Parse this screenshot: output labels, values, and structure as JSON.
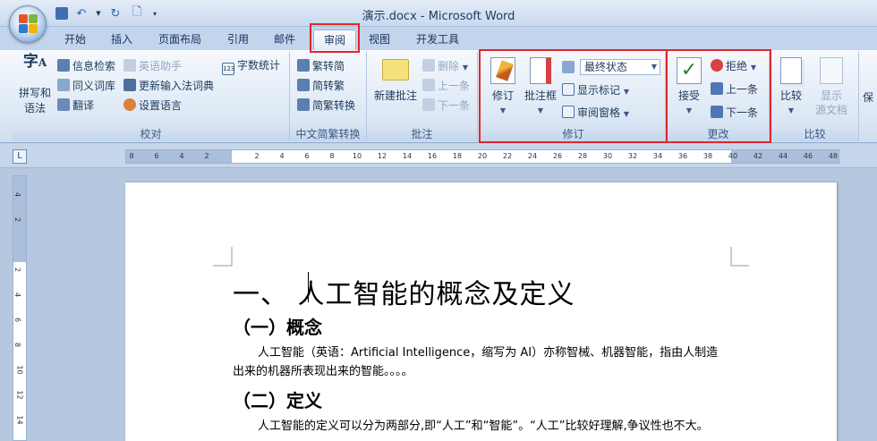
{
  "window": {
    "title": "演示.docx - Microsoft Word"
  },
  "quick_access": [
    "save-icon",
    "undo-icon",
    "redo-icon",
    "print-preview-icon",
    "customize-icon"
  ],
  "tabs": [
    {
      "label": "开始"
    },
    {
      "label": "插入"
    },
    {
      "label": "页面布局"
    },
    {
      "label": "引用"
    },
    {
      "label": "邮件"
    },
    {
      "label": "审阅",
      "active": true
    },
    {
      "label": "视图"
    },
    {
      "label": "开发工具"
    }
  ],
  "ribbon": {
    "proofing": {
      "label": "校对",
      "spell": "拼写和",
      "spell2": "语法",
      "research": "信息检索",
      "thesaurus": "同义词库",
      "translate": "翻译",
      "english_assist": "英语助手",
      "update_ime": "更新输入法词典",
      "set_language": "设置语言",
      "word_count": "字数统计"
    },
    "chinese": {
      "label": "中文简繁转换",
      "to_simplified": "繁转简",
      "to_traditional": "简转繁",
      "convert": "简繁转换"
    },
    "comments": {
      "label": "批注",
      "new": "新建批注",
      "delete": "删除",
      "previous": "上一条",
      "next": "下一条"
    },
    "tracking": {
      "label": "修订",
      "track": "修订",
      "balloons": "批注框",
      "display": "最终状态",
      "show_markup": "显示标记",
      "reviewing_pane": "审阅窗格"
    },
    "changes": {
      "label": "更改",
      "accept": "接受",
      "reject": "拒绝",
      "previous": "上一条",
      "next": "下一条"
    },
    "compare": {
      "label": "比较",
      "compare": "比较",
      "show_source": "显示",
      "show_source2": "源文档",
      "protect": "保"
    }
  },
  "ruler": {
    "ticks": [
      "8",
      "6",
      "4",
      "2",
      "",
      "2",
      "4",
      "6",
      "8",
      "10",
      "12",
      "14",
      "16",
      "18",
      "20",
      "22",
      "24",
      "26",
      "28",
      "30",
      "32",
      "34",
      "36",
      "38",
      "40",
      "42",
      "44",
      "46",
      "48"
    ],
    "vticks": [
      "4",
      "2",
      "",
      "2",
      "4",
      "6",
      "8",
      "10",
      "12",
      "14"
    ]
  },
  "document": {
    "heading1": "一、  人工智能的概念及定义",
    "heading2a": "（一）概念",
    "para1_line1": "人工智能（英语：Artificial Intelligence，缩写为 AI）亦称智械、机器智能，指由人制造",
    "para1_line2": "出来的机器所表现出来的智能。。。。",
    "heading2b": "（二）定义",
    "para2_line1": "人工智能的定义可以分为两部分,即“人工”和“智能”。“人工”比较好理解,争议性也不大。"
  }
}
